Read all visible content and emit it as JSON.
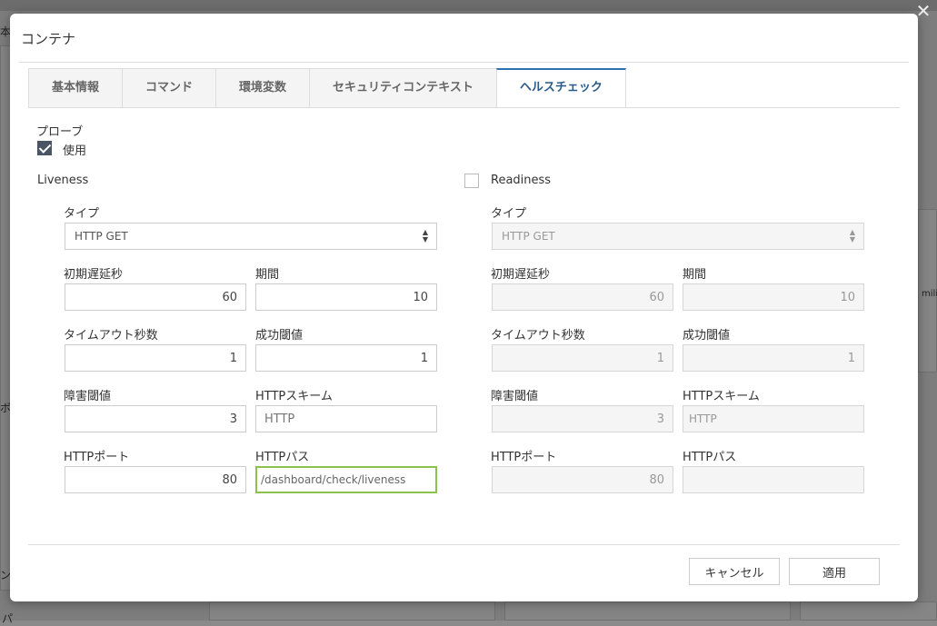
{
  "dialog": {
    "title": "コンテナ",
    "close_glyph": "✕"
  },
  "tabs": [
    {
      "label": "基本情報",
      "active": false
    },
    {
      "label": "コマンド",
      "active": false
    },
    {
      "label": "環境変数",
      "active": false
    },
    {
      "label": "セキュリティコンテキスト",
      "active": false
    },
    {
      "label": "ヘルスチェック",
      "active": true
    }
  ],
  "probe": {
    "label": "プローブ",
    "use_label": "使用",
    "use_checked": true
  },
  "liveness": {
    "title": "Liveness",
    "type_label": "タイプ",
    "type_value": "HTTP GET",
    "initial_delay_label": "初期遅延秒",
    "initial_delay": "60",
    "period_label": "期間",
    "period": "10",
    "timeout_label": "タイムアウト秒数",
    "timeout": "1",
    "success_label": "成功閾値",
    "success": "1",
    "failure_label": "障害閾値",
    "failure": "3",
    "scheme_label": "HTTPスキーム",
    "scheme": "HTTP",
    "port_label": "HTTPポート",
    "port": "80",
    "path_label": "HTTPパス",
    "path": "/dashboard/check/liveness"
  },
  "readiness": {
    "title": "Readiness",
    "checked": false,
    "type_label": "タイプ",
    "type_value": "HTTP GET",
    "initial_delay_label": "初期遅延秒",
    "initial_delay": "60",
    "period_label": "期間",
    "period": "10",
    "timeout_label": "タイムアウト秒数",
    "timeout": "1",
    "success_label": "成功閾値",
    "success": "1",
    "failure_label": "障害閾値",
    "failure": "3",
    "scheme_label": "HTTPスキーム",
    "scheme": "HTTP",
    "port_label": "HTTPポート",
    "port": "80",
    "path_label": "HTTPパス",
    "path": ""
  },
  "footer": {
    "cancel_label": "キャンセル",
    "apply_label": "適用"
  },
  "background": {
    "frag_1": "本",
    "frag_2": "ボ",
    "frag_3": "ン",
    "frag_4": "パ",
    "frag_5": "mili"
  }
}
